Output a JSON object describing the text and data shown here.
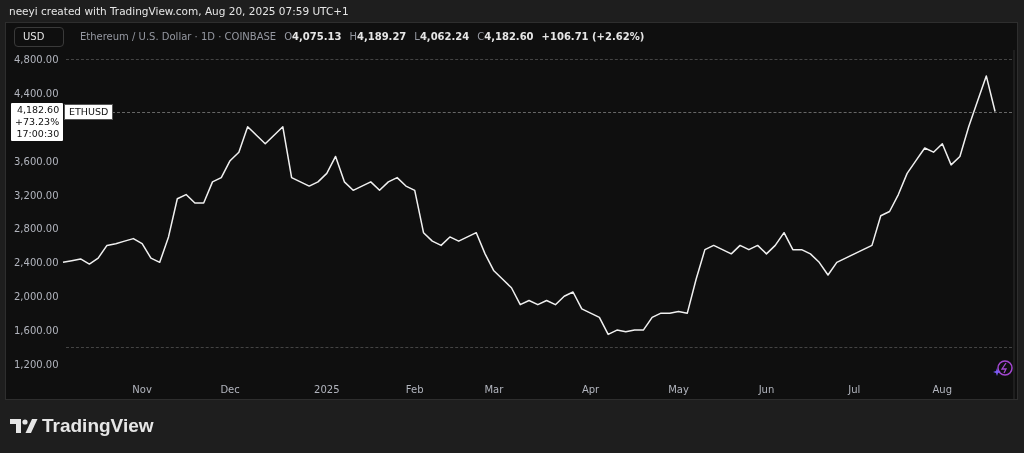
{
  "attribution": "neeyi created with TradingView.com, Aug 20, 2025 07:59 UTC+1",
  "header": {
    "currency": "USD",
    "symbol_title": "Ethereum / U.S. Dollar · 1D · COINBASE",
    "ohlc": [
      {
        "label": "O",
        "value": "4,075.13"
      },
      {
        "label": "H",
        "value": "4,189.27"
      },
      {
        "label": "L",
        "value": "4,062.24"
      },
      {
        "label": "C",
        "value": "4,182.60"
      }
    ],
    "change": "+106.71 (+2.62%)"
  },
  "price_label": {
    "price": "4,182.60",
    "change": "+73.23%",
    "countdown": "17:00:30"
  },
  "chart": {
    "chart_data": {
      "type": "line",
      "ylim": [
        1200,
        4800
      ],
      "yticks": [
        {
          "value": 1200,
          "label": "1,200.00"
        },
        {
          "value": 1600,
          "label": "1,600.00"
        },
        {
          "value": 2000,
          "label": "2,000.00"
        },
        {
          "value": 2400,
          "label": "2,400.00"
        },
        {
          "value": 2800,
          "label": "2,800.00"
        },
        {
          "value": 3200,
          "label": "3,200.00"
        },
        {
          "value": 3600,
          "label": "3,600.00"
        },
        {
          "value": 4400,
          "label": "4,400.00"
        },
        {
          "value": 4800,
          "label": "4,800.00"
        }
      ],
      "categories": [
        null,
        null,
        null,
        null,
        null,
        null,
        null,
        null,
        null,
        "Nov",
        null,
        null,
        null,
        null,
        null,
        null,
        null,
        null,
        null,
        "Dec",
        null,
        null,
        null,
        null,
        null,
        null,
        null,
        null,
        null,
        null,
        "2025",
        null,
        null,
        null,
        null,
        null,
        null,
        null,
        null,
        null,
        "Feb",
        null,
        null,
        null,
        null,
        null,
        null,
        null,
        null,
        "Mar",
        null,
        null,
        null,
        null,
        null,
        null,
        null,
        null,
        null,
        null,
        "Apr",
        null,
        null,
        null,
        null,
        null,
        null,
        null,
        null,
        null,
        "May",
        null,
        null,
        null,
        null,
        null,
        null,
        null,
        null,
        null,
        "Jun",
        null,
        null,
        null,
        null,
        null,
        null,
        null,
        null,
        null,
        "Jul",
        null,
        null,
        null,
        null,
        null,
        null,
        null,
        null,
        null,
        "Aug",
        null,
        null,
        null,
        null,
        null,
        null
      ],
      "series": [
        {
          "name": "ETHUSD",
          "values": [
            2400,
            2420,
            2440,
            2380,
            2450,
            2600,
            2620,
            2650,
            2680,
            2620,
            2450,
            2400,
            2700,
            3150,
            3200,
            3100,
            3100,
            3350,
            3400,
            3600,
            3700,
            4000,
            3900,
            3800,
            3900,
            4000,
            3400,
            3350,
            3300,
            3350,
            3450,
            3650,
            3350,
            3250,
            3300,
            3350,
            3250,
            3350,
            3400,
            3300,
            3250,
            2750,
            2650,
            2600,
            2700,
            2650,
            2700,
            2750,
            2500,
            2300,
            2200,
            2100,
            1900,
            1950,
            1900,
            1950,
            1900,
            2000,
            2050,
            1850,
            1800,
            1750,
            1550,
            1600,
            1580,
            1600,
            1600,
            1750,
            1800,
            1800,
            1820,
            1800,
            2200,
            2550,
            2600,
            2550,
            2500,
            2600,
            2550,
            2600,
            2500,
            2600,
            2750,
            2550,
            2550,
            2500,
            2400,
            2250,
            2400,
            2450,
            2500,
            2550,
            2600,
            2950,
            3000,
            3200,
            3450,
            3600,
            3750,
            3700,
            3800,
            3550,
            3650,
            4000,
            4300,
            4600,
            4180
          ]
        }
      ]
    }
  },
  "footer": {
    "brand": "TradingView"
  }
}
